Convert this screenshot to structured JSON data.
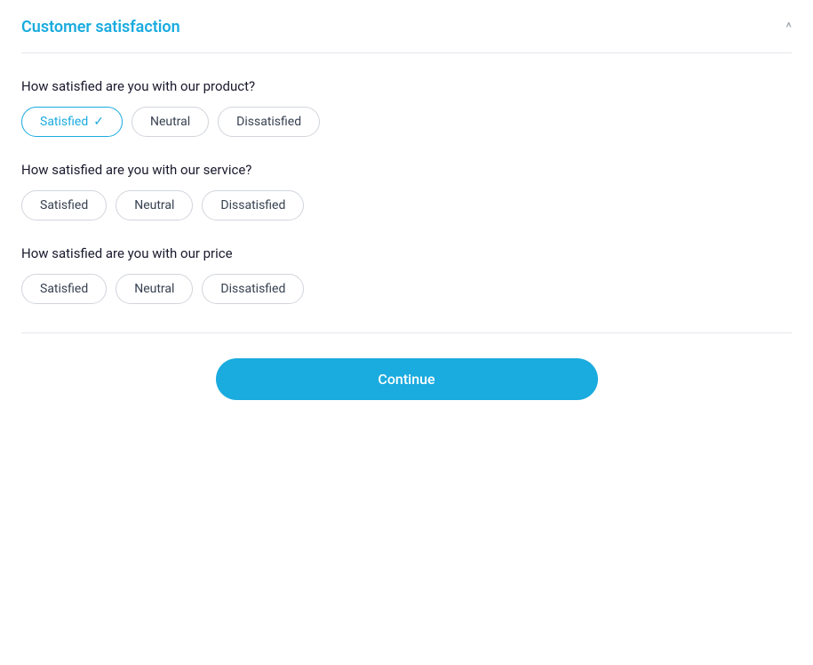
{
  "header": {
    "title": "Customer satisfaction",
    "collapse_icon": "^"
  },
  "questions": [
    {
      "id": "product",
      "text": "How satisfied are you with our product?",
      "options": [
        {
          "label": "Satisfied",
          "selected": true
        },
        {
          "label": "Neutral",
          "selected": false
        },
        {
          "label": "Dissatisfied",
          "selected": false
        }
      ]
    },
    {
      "id": "service",
      "text": "How satisfied are you with our service?",
      "options": [
        {
          "label": "Satisfied",
          "selected": false
        },
        {
          "label": "Neutral",
          "selected": false
        },
        {
          "label": "Dissatisfied",
          "selected": false
        }
      ]
    },
    {
      "id": "price",
      "text": "How satisfied are you with our price",
      "options": [
        {
          "label": "Satisfied",
          "selected": false
        },
        {
          "label": "Neutral",
          "selected": false
        },
        {
          "label": "Dissatisfied",
          "selected": false
        }
      ]
    }
  ],
  "continue_button": "Continue"
}
